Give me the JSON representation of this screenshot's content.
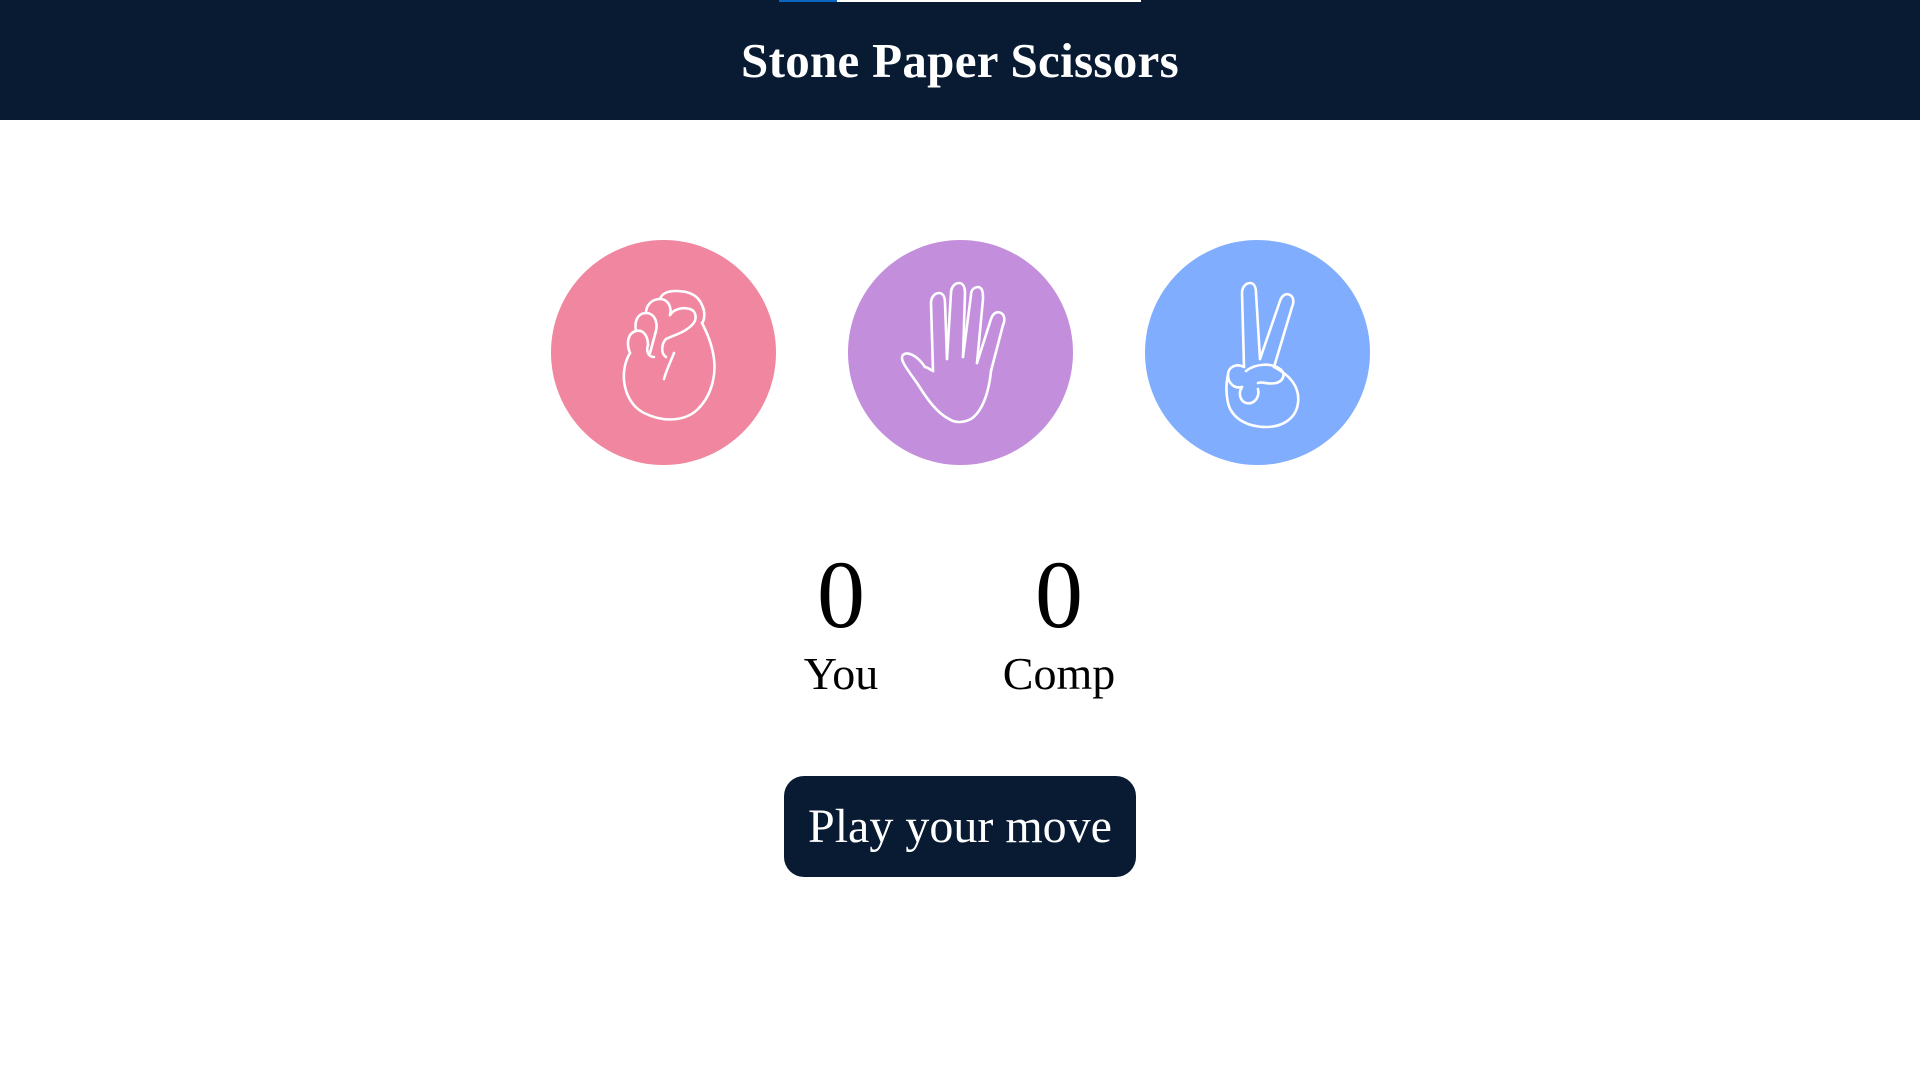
{
  "app": {
    "title": "Stone Paper Scissors",
    "loading_progress": 0.16
  },
  "choices": [
    {
      "id": "stone",
      "icon": "fist-icon",
      "color": "#f0869f"
    },
    {
      "id": "paper",
      "icon": "open-hand-icon",
      "color": "#c38fdc"
    },
    {
      "id": "scissors",
      "icon": "peace-hand-icon",
      "color": "#80adfd"
    }
  ],
  "scoreboard": {
    "user_score": "0",
    "user_label": "You",
    "comp_score": "0",
    "comp_label": "Comp"
  },
  "message": {
    "text": "Play your move",
    "background": "#081b33"
  },
  "colors": {
    "header_bg": "#081b33",
    "progress_fill": "#0a66c2"
  }
}
